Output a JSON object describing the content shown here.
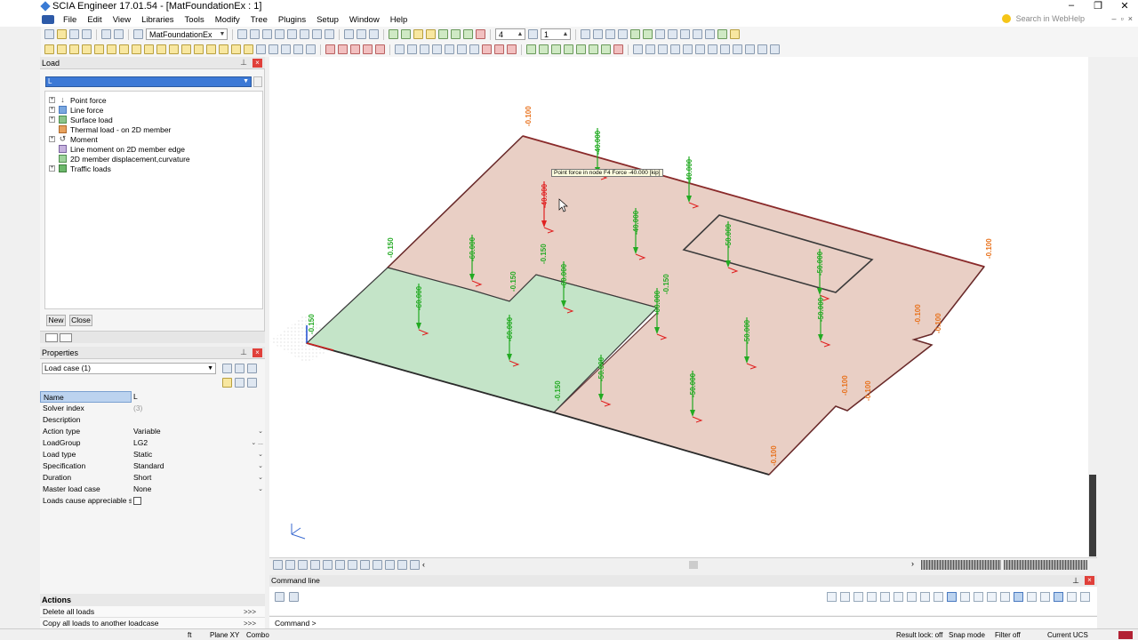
{
  "window": {
    "title": "SCIA Engineer 17.01.54 - [MatFoundationEx : 1]",
    "minimize": "–",
    "restore": "❐",
    "close": "✕"
  },
  "menu": {
    "items": [
      "File",
      "Edit",
      "View",
      "Libraries",
      "Tools",
      "Modify",
      "Tree",
      "Plugins",
      "Setup",
      "Window",
      "Help"
    ],
    "search_placeholder": "Search in WebHelp"
  },
  "toolbar": {
    "project_combo": "MatFoundationEx",
    "spin1": "4",
    "spin2": "1"
  },
  "load_panel": {
    "title": "Load",
    "current": "L",
    "tree": [
      {
        "label": "Point force",
        "expand": "+"
      },
      {
        "label": "Line force",
        "expand": "+"
      },
      {
        "label": "Surface load",
        "expand": "+"
      },
      {
        "label": "Thermal load - on 2D member",
        "expand": ""
      },
      {
        "label": "Moment",
        "expand": "+"
      },
      {
        "label": "Line moment on 2D member edge",
        "expand": ""
      },
      {
        "label": "2D member displacement,curvature",
        "expand": ""
      },
      {
        "label": "Traffic loads",
        "expand": "+"
      }
    ],
    "new_btn": "New",
    "close_btn": "Close"
  },
  "properties": {
    "title": "Properties",
    "selector": "Load case (1)",
    "rows": [
      {
        "key": "Name",
        "value": "L",
        "dd": ""
      },
      {
        "key": "Solver index",
        "value": "(3)",
        "dd": ""
      },
      {
        "key": "Description",
        "value": "",
        "dd": ""
      },
      {
        "key": "Action type",
        "value": "Variable",
        "dd": "⌄"
      },
      {
        "key": "LoadGroup",
        "value": "LG2",
        "dd": "⌄ ..."
      },
      {
        "key": "Load type",
        "value": "Static",
        "dd": "⌄"
      },
      {
        "key": "Specification",
        "value": "Standard",
        "dd": "⌄"
      },
      {
        "key": "Duration",
        "value": "Short",
        "dd": "⌄"
      },
      {
        "key": "Master load case",
        "value": "None",
        "dd": "⌄"
      },
      {
        "key": "Loads cause appreciable sid...",
        "value": "",
        "dd": ""
      }
    ]
  },
  "actions": {
    "title": "Actions",
    "items": [
      {
        "label": "Delete all loads",
        "arrow": ">>>"
      },
      {
        "label": "Copy all loads to another loadcase",
        "arrow": ">>>"
      }
    ]
  },
  "viewport": {
    "tooltip": "Point force in node F4 Force  -40.000 [kip]",
    "point_loads": [
      {
        "label": "-40.000",
        "highlight": false
      },
      {
        "label": "-40.000",
        "highlight": true
      },
      {
        "label": "-40.000",
        "highlight": false
      },
      {
        "label": "-40.000",
        "highlight": false
      },
      {
        "label": "-60.000",
        "highlight": false
      },
      {
        "label": "-60.000",
        "highlight": false
      },
      {
        "label": "-60.000",
        "highlight": false
      },
      {
        "label": "-60.000",
        "highlight": false
      },
      {
        "label": "-60.000",
        "highlight": false
      },
      {
        "label": "-50.000",
        "highlight": false
      },
      {
        "label": "-50.000",
        "highlight": false
      },
      {
        "label": "-50.000",
        "highlight": false
      },
      {
        "label": "-50.000",
        "highlight": false
      },
      {
        "label": "-50.000",
        "highlight": false
      },
      {
        "label": "-50.000",
        "highlight": false
      }
    ],
    "line_loads_green": [
      "-0.150",
      "-0.150",
      "-0.150",
      "-0.150",
      "-0.150",
      "-0.150"
    ],
    "line_loads_orange": [
      "-0.100",
      "-0.100",
      "-0.100",
      "-0.100",
      "-0.100",
      "-0.100",
      "-0.100"
    ],
    "colors": {
      "slab_fill": "#e9cfc5",
      "green_fill": "#c4e4c8",
      "point_load": "#22aa22",
      "edge_load": "#e8701a",
      "highlight": "#e02020"
    }
  },
  "command": {
    "title": "Command line",
    "prompt": "Command >"
  },
  "status": {
    "unit": "ft",
    "plane": "Plane XY",
    "combo": "Combo",
    "result_lock": "Result lock: off",
    "snap": "Snap mode",
    "filter": "Filter off",
    "ucs": "Current UCS",
    "lang_flag": "US"
  }
}
